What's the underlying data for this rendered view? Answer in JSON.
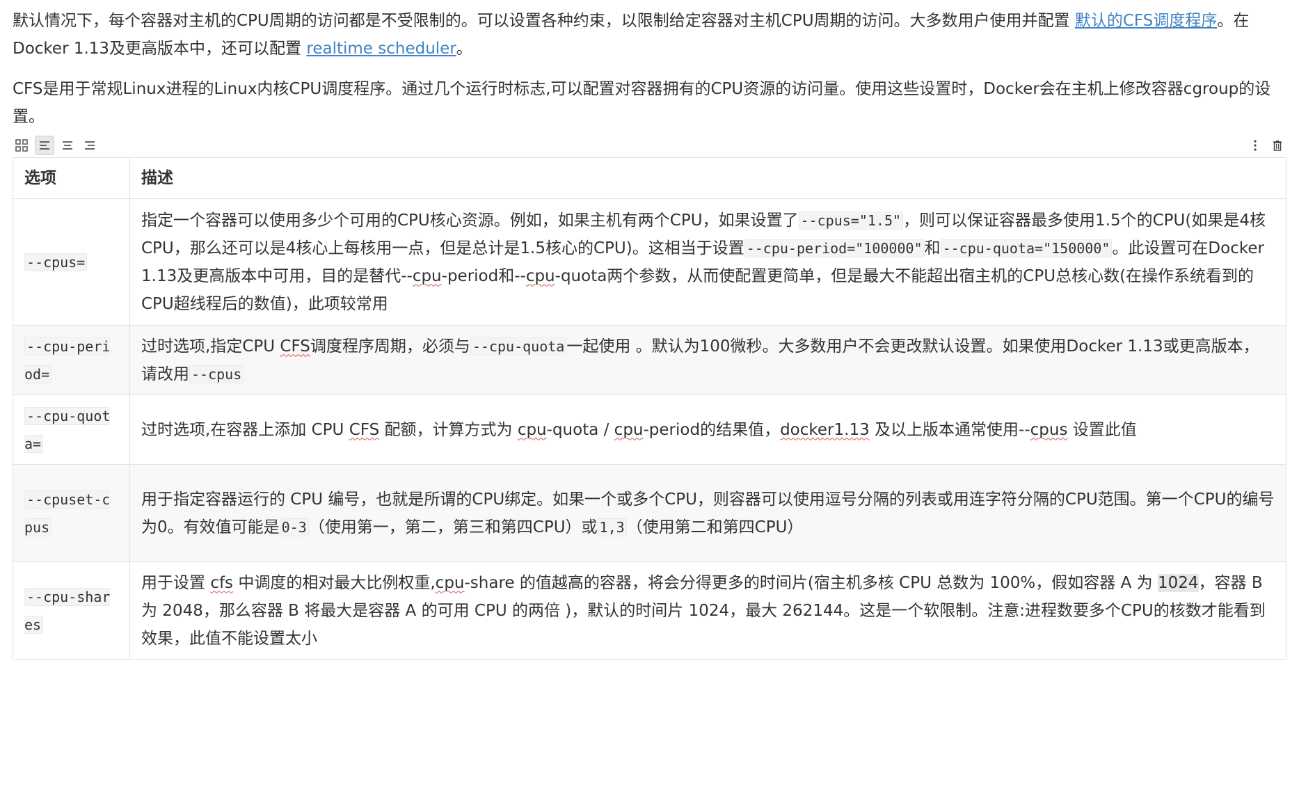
{
  "intro": {
    "p1_a": "默认情况下，每个容器对主机的CPU周期的访问都是不受限制的。可以设置各种约束，以限制给定容器对主机CPU周期的访问。大多数用户使用并配置 ",
    "p1_link1": "默认的CFS调度程序",
    "p1_b": "。在Docker 1.13及更高版本中，还可以配置 ",
    "p1_link2": "realtime scheduler",
    "p1_c": "。",
    "p2": "CFS是用于常规Linux进程的Linux内核CPU调度程序。通过几个运行时标志,可以配置对容器拥有的CPU资源的访问量。使用这些设置时，Docker会在主机上修改容器cgroup的设置。"
  },
  "toolbar": {
    "left_icons": [
      "grid-icon",
      "align-left-icon",
      "align-center-icon",
      "align-right-icon"
    ],
    "right_icons": [
      "more-vertical-icon",
      "trash-icon"
    ]
  },
  "table": {
    "headers": [
      "选项",
      "描述"
    ],
    "rows": {
      "cpus": {
        "option": "--cpus=",
        "d1": "指定一个容器可以使用多少个可用的CPU核心资源。例如，如果主机有两个CPU，如果设置了",
        "c1": "--cpus=\"1.5\"",
        "d2": "，则可以保证容器最多使用1.5个的CPU(如果是4核CPU，那么还可以是4核心上每核用一点，但是总计是1.5核心的CPU)。这相当于设置",
        "c2": "--cpu-period=\"100000\"",
        "d3": "和",
        "c3": "--cpu-quota=\"150000\"",
        "d4": "。此设置可在Docker 1.13及更高版本中可用，目的是替代--",
        "w1": "cpu",
        "d5": "-period和--",
        "w2": "cpu",
        "d6": "-quota两个参数，从而使配置更简单，但是最大不能超出宿主机的CPU总核心数(在操作系统看到的CPU超线程后的数值)，此项较常用"
      },
      "period": {
        "option": "--cpu-period=",
        "d1": "过时选项,指定CPU ",
        "w1": "CFS",
        "d2": "调度程序周期，必须与",
        "c1": "--cpu-quota",
        "d3": "一起使用 。默认为100微秒。大多数用户不会更改默认设置。如果使用Docker 1.13或更高版本，请改用",
        "c2": "--cpus"
      },
      "quota": {
        "option": "--cpu-quota=",
        "d1": "过时选项,在容器上添加 CPU ",
        "w1": "CFS",
        "d2": " 配额，计算方式为 ",
        "w2": "cpu",
        "d3": "-quota / ",
        "w3": "cpu",
        "d4": "-period的结果值，",
        "w4": "docker1.13",
        "d5": " 及以上版本通常使用--",
        "w5": "cpus",
        "d6": " 设置此值"
      },
      "cpuset": {
        "option": "--cpuset-cpus",
        "d1": "用于指定容器运行的 CPU 编号，也就是所谓的CPU绑定。如果一个或多个CPU，则容器可以使用逗号分隔的列表或用连字符分隔的CPU范围。第一个CPU的编号为0。有效值可能是",
        "c1": "0-3",
        "d2": "（使用第一，第二，第三和第四CPU）或",
        "c2": "1,3",
        "d3": "（使用第二和第四CPU）"
      },
      "shares": {
        "option": "--cpu-shares",
        "d1": "用于设置 ",
        "w1": "cfs",
        "d2": " 中调度的相对最大比例权重,",
        "w2": "cpu",
        "d3": "-share 的值越高的容器，将会分得更多的时间片(宿主机多核 CPU 总数为 100%，假如容器 A 为 ",
        "h1": "1024",
        "d4": "，容器 B 为 2048，那么容器 B 将最大是容器 A 的可用 CPU 的两倍 )，默认的时间片 1024，最大 262144。这是一个软限制。注意:进程数要多个CPU的核数才能看到效果，此值不能设置太小"
      }
    }
  }
}
